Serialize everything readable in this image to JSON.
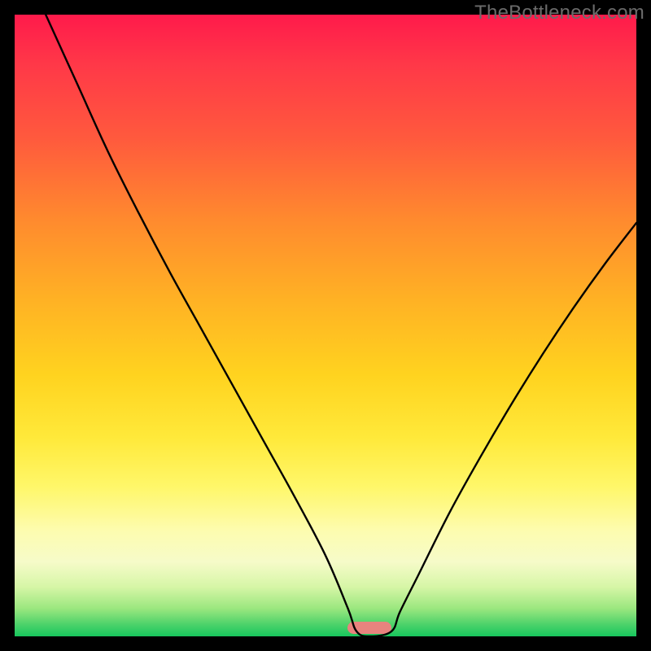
{
  "watermark": "TheBottleneck.com",
  "chart_data": {
    "type": "line",
    "title": "",
    "xlabel": "",
    "ylabel": "",
    "xlim": [
      0,
      100
    ],
    "ylim": [
      0,
      100
    ],
    "grid": false,
    "legend": false,
    "background": {
      "style": "vertical-gradient",
      "top_color": "#ff1a4b",
      "bottom_color": "#17c65d",
      "meaning": "high value = red (bad), low value = green (good)"
    },
    "series": [
      {
        "name": "bottleneck-curve",
        "color": "#000000",
        "x": [
          5.0,
          10.0,
          15.0,
          20.0,
          25.0,
          30.0,
          35.0,
          40.0,
          45.0,
          50.0,
          53.6,
          55.0,
          57.1,
          60.6,
          62.0,
          65.0,
          70.0,
          75.0,
          80.0,
          85.0,
          90.0,
          95.0,
          100.0
        ],
        "values": [
          100.0,
          89.0,
          78.0,
          68.0,
          58.5,
          49.5,
          40.5,
          31.5,
          22.5,
          13.0,
          4.5,
          0.8,
          0.0,
          0.8,
          4.0,
          10.0,
          20.0,
          29.0,
          37.5,
          45.5,
          53.0,
          60.0,
          66.5
        ]
      }
    ],
    "annotations": [
      {
        "name": "optimal-marker",
        "shape": "rounded-rect",
        "color": "#e8837e",
        "x": 57.1,
        "y": 0.0,
        "width_pct": 7.0,
        "height_pct": 2.0
      }
    ]
  }
}
